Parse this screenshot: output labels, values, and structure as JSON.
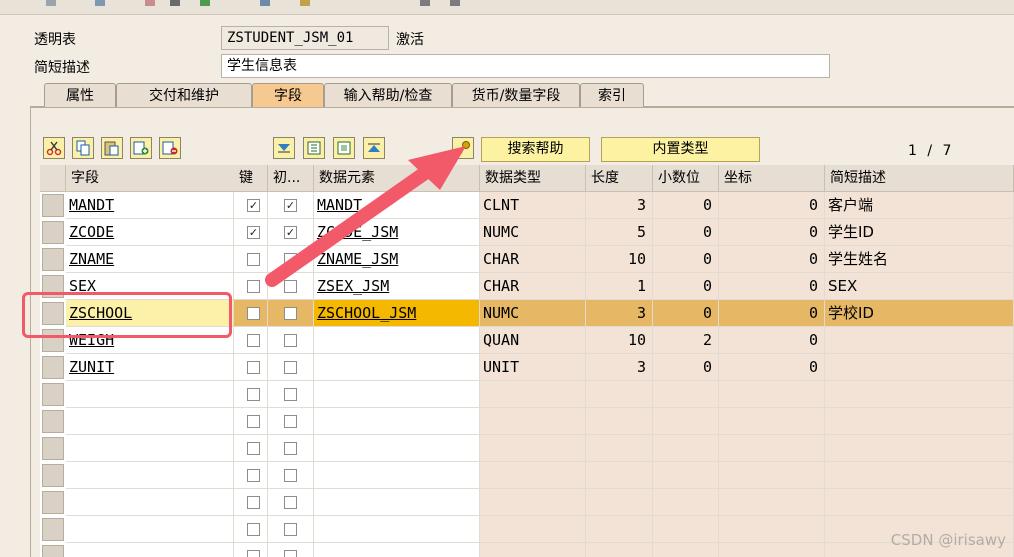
{
  "header": {
    "table_label": "透明表",
    "table_name": "ZSTUDENT_JSM_01",
    "status": "激活",
    "desc_label": "简短描述",
    "description": "学生信息表"
  },
  "tabs": [
    {
      "label": "属性",
      "active": false
    },
    {
      "label": "交付和维护",
      "active": false
    },
    {
      "label": "字段",
      "active": true
    },
    {
      "label": "输入帮助/检查",
      "active": false
    },
    {
      "label": "货币/数量字段",
      "active": false
    },
    {
      "label": "索引",
      "active": false
    }
  ],
  "toolbar": {
    "search_help_label": "搜索帮助",
    "builtin_type_label": "内置类型",
    "page_current": "1",
    "page_sep": "/",
    "page_total": "7"
  },
  "columns": [
    "字段",
    "键",
    "初...",
    "数据元素",
    "数据类型",
    "长度",
    "小数位",
    "坐标",
    "简短描述"
  ],
  "rows": [
    {
      "field": "MANDT",
      "key": true,
      "init": true,
      "element": "MANDT",
      "dtype": "CLNT",
      "length": "3",
      "decimals": "0",
      "coord": "0",
      "desc": "客户端"
    },
    {
      "field": "ZCODE",
      "key": true,
      "init": true,
      "element": "ZCODE_JSM",
      "dtype": "NUMC",
      "length": "5",
      "decimals": "0",
      "coord": "0",
      "desc": "学生ID"
    },
    {
      "field": "ZNAME",
      "key": false,
      "init": false,
      "element": "ZNAME_JSM",
      "dtype": "CHAR",
      "length": "10",
      "decimals": "0",
      "coord": "0",
      "desc": "学生姓名"
    },
    {
      "field": "SEX",
      "key": false,
      "init": false,
      "element": "ZSEX_JSM",
      "dtype": "CHAR",
      "length": "1",
      "decimals": "0",
      "coord": "0",
      "desc": "SEX"
    },
    {
      "field": "ZSCHOOL",
      "key": false,
      "init": false,
      "element": "ZSCHOOL_JSM",
      "dtype": "NUMC",
      "length": "3",
      "decimals": "0",
      "coord": "0",
      "desc": "学校ID"
    },
    {
      "field": "WEIGH",
      "key": false,
      "init": false,
      "element": "",
      "dtype": "QUAN",
      "length": "10",
      "decimals": "2",
      "coord": "0",
      "desc": ""
    },
    {
      "field": "ZUNIT",
      "key": false,
      "init": false,
      "element": "",
      "dtype": "UNIT",
      "length": "3",
      "decimals": "0",
      "coord": "0",
      "desc": ""
    }
  ],
  "selected_row": 4,
  "empty_rows": 7,
  "colors": {
    "highlight_row": "#e6b866",
    "highlight_cell": "#f5b800",
    "annotation": "#f25a6a"
  },
  "watermark": "CSDN @irisawy"
}
